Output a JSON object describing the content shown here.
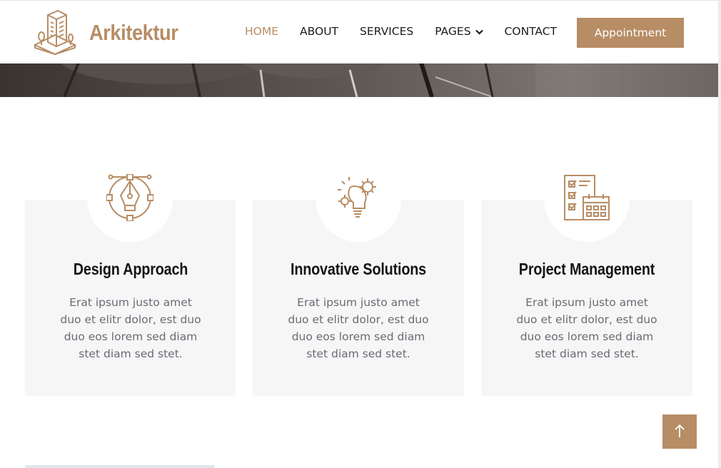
{
  "brand": {
    "name": "Arkitektur",
    "logo_icon": "building-logo-icon",
    "color": "#b78d65"
  },
  "nav": {
    "items": [
      {
        "label": "HOME",
        "active": true
      },
      {
        "label": "ABOUT",
        "active": false
      },
      {
        "label": "SERVICES",
        "active": false
      },
      {
        "label": "PAGES",
        "active": false,
        "dropdown": true
      },
      {
        "label": "CONTACT",
        "active": false
      }
    ],
    "cta_label": "Appointment"
  },
  "features": [
    {
      "icon": "pen-tool-icon",
      "title": "Design Approach",
      "text": "Erat ipsum justo amet duo et elitr dolor, est duo duo eos lorem sed diam stet diam sed stet."
    },
    {
      "icon": "gear-lightbulb-icon",
      "title": "Innovative Solutions",
      "text": "Erat ipsum justo amet duo et elitr dolor, est duo duo eos lorem sed diam stet diam sed stet."
    },
    {
      "icon": "checklist-calendar-icon",
      "title": "Project Management",
      "text": "Erat ipsum justo amet duo et elitr dolor, est duo duo eos lorem sed diam stet diam sed stet."
    }
  ],
  "back_to_top_icon": "arrow-up-icon",
  "colors": {
    "accent": "#b78d65",
    "card_bg": "#f6f6f6",
    "heading": "#151515",
    "body_text": "#6b6a75"
  }
}
